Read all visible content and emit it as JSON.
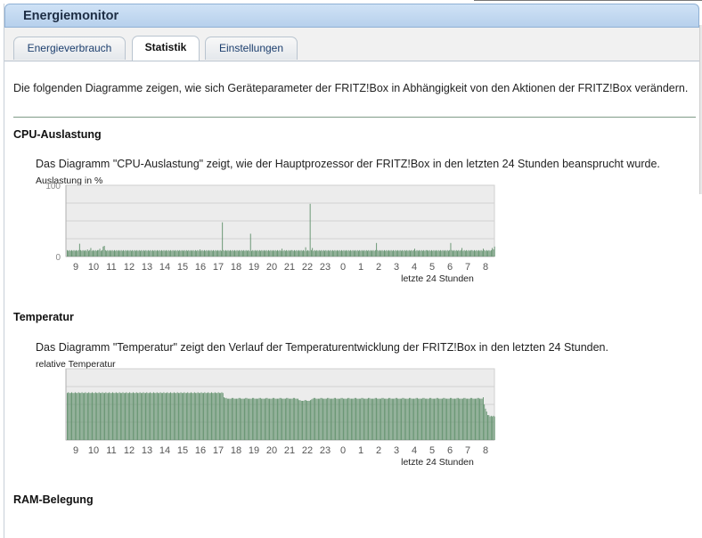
{
  "window": {
    "title": "Energiemonitor"
  },
  "tabs": [
    {
      "label": "Energieverbrauch",
      "active": false
    },
    {
      "label": "Statistik",
      "active": true
    },
    {
      "label": "Einstellungen",
      "active": false
    }
  ],
  "intro_text": "Die folgenden Diagramme zeigen, wie sich Geräteparameter der FRITZ!Box in Abhängigkeit von den Aktionen der FRITZ!Box verändern.",
  "sections": [
    {
      "title": "CPU-Auslastung",
      "description": "Das Diagramm \"CPU-Auslastung\" zeigt, wie der Hauptprozessor der FRITZ!Box in den letzten 24 Stunden beansprucht wurde."
    },
    {
      "title": "Temperatur",
      "description": "Das Diagramm \"Temperatur\" zeigt den Verlauf der Temperaturentwicklung der FRITZ!Box in den letzten 24 Stunden."
    },
    {
      "title": "RAM-Belegung"
    }
  ],
  "colors": {
    "bar": "#5f8f6a",
    "plot_bg": "#ececec",
    "grid": "#d2d2d2",
    "rule": "#7f9b87"
  },
  "chart_data": [
    {
      "type": "bar",
      "ylabel": "Auslastung in %",
      "xlabel": "letzte 24 Stunden",
      "ylim": [
        0,
        100
      ],
      "yticks": [
        "100",
        "0"
      ],
      "categories": [
        "9",
        "10",
        "11",
        "12",
        "13",
        "14",
        "15",
        "16",
        "17",
        "18",
        "19",
        "20",
        "21",
        "22",
        "23",
        "0",
        "1",
        "2",
        "3",
        "4",
        "5",
        "6",
        "7",
        "8"
      ],
      "grid": true,
      "values": [
        9,
        8,
        9,
        8,
        9,
        8,
        9,
        8,
        9,
        8,
        9,
        18,
        9,
        8,
        9,
        8,
        9,
        8,
        10,
        8,
        9,
        12,
        8,
        9,
        8,
        9,
        8,
        9,
        9,
        11,
        8,
        9,
        14,
        15,
        9,
        8,
        9,
        8,
        9,
        8,
        9,
        8,
        9,
        8,
        9,
        8,
        9,
        8,
        9,
        8,
        9,
        8,
        9,
        8,
        9,
        8,
        9,
        8,
        9,
        8,
        9,
        8,
        9,
        8,
        9,
        8,
        9,
        8,
        9,
        8,
        9,
        8,
        9,
        8,
        9,
        8,
        9,
        8,
        9,
        8,
        9,
        8,
        9,
        8,
        9,
        8,
        9,
        8,
        9,
        8,
        9,
        8,
        9,
        8,
        9,
        8,
        9,
        8,
        9,
        8,
        9,
        8,
        9,
        8,
        9,
        8,
        9,
        8,
        9,
        8,
        9,
        8,
        9,
        8,
        9,
        8,
        9,
        8,
        10,
        8,
        9,
        8,
        9,
        8,
        9,
        8,
        9,
        8,
        9,
        8,
        9,
        8,
        9,
        8,
        9,
        8,
        9,
        8,
        48,
        9,
        8,
        9,
        8,
        9,
        8,
        9,
        8,
        9,
        8,
        9,
        8,
        9,
        8,
        9,
        8,
        9,
        8,
        9,
        8,
        9,
        8,
        9,
        8,
        32,
        8,
        9,
        8,
        9,
        8,
        9,
        8,
        9,
        8,
        9,
        8,
        9,
        8,
        9,
        8,
        9,
        8,
        9,
        8,
        9,
        8,
        9,
        8,
        9,
        8,
        9,
        8,
        11,
        8,
        9,
        8,
        9,
        8,
        9,
        8,
        9,
        9,
        8,
        9,
        8,
        9,
        8,
        9,
        8,
        9,
        8,
        9,
        8,
        13,
        8,
        9,
        8,
        74,
        9,
        12,
        8,
        9,
        8,
        9,
        8,
        9,
        8,
        9,
        8,
        9,
        8,
        9,
        8,
        9,
        8,
        9,
        8,
        9,
        8,
        9,
        8,
        9,
        8,
        9,
        8,
        9,
        8,
        9,
        8,
        9,
        8,
        9,
        8,
        9,
        8,
        9,
        8,
        9,
        8,
        9,
        8,
        9,
        8,
        9,
        8,
        9,
        8,
        9,
        8,
        9,
        8,
        9,
        8,
        9,
        8,
        9,
        19,
        9,
        8,
        9,
        8,
        9,
        8,
        9,
        8,
        9,
        8,
        9,
        8,
        9,
        8,
        9,
        8,
        9,
        8,
        9,
        8,
        9,
        8,
        9,
        8,
        9,
        8,
        9,
        8,
        9,
        8,
        9,
        8,
        9,
        11,
        8,
        9,
        8,
        9,
        8,
        9,
        8,
        9,
        8,
        9,
        9,
        8,
        9,
        8,
        9,
        8,
        9,
        8,
        9,
        8,
        9,
        8,
        9,
        8,
        9,
        8,
        9,
        8,
        9,
        8,
        9,
        19,
        9,
        8,
        9,
        8,
        9,
        8,
        9,
        8,
        9,
        12,
        8,
        9,
        8,
        9,
        8,
        9,
        8,
        9,
        9,
        8,
        9,
        8,
        9,
        8,
        9,
        8,
        9,
        8,
        11,
        9,
        8,
        9,
        8,
        9,
        8,
        9,
        12,
        10,
        14
      ]
    },
    {
      "type": "bar",
      "ylabel": "relative Temperatur",
      "xlabel": "letzte 24 Stunden",
      "ylim": [
        0,
        100
      ],
      "categories": [
        "9",
        "10",
        "11",
        "12",
        "13",
        "14",
        "15",
        "16",
        "17",
        "18",
        "19",
        "20",
        "21",
        "22",
        "23",
        "0",
        "1",
        "2",
        "3",
        "4",
        "5",
        "6",
        "7",
        "8"
      ],
      "grid": true,
      "values": [
        66,
        67,
        66,
        66,
        67,
        66,
        66,
        67,
        66,
        66,
        67,
        66,
        66,
        67,
        66,
        66,
        67,
        66,
        66,
        67,
        66,
        66,
        67,
        66,
        66,
        67,
        66,
        66,
        67,
        66,
        66,
        67,
        66,
        66,
        67,
        66,
        66,
        67,
        66,
        66,
        67,
        66,
        66,
        67,
        66,
        66,
        67,
        66,
        66,
        67,
        66,
        66,
        67,
        66,
        66,
        67,
        66,
        66,
        67,
        66,
        66,
        67,
        66,
        66,
        67,
        66,
        66,
        67,
        66,
        66,
        67,
        66,
        66,
        67,
        66,
        66,
        67,
        66,
        66,
        67,
        66,
        66,
        67,
        66,
        66,
        67,
        66,
        66,
        67,
        66,
        66,
        67,
        66,
        66,
        67,
        66,
        66,
        67,
        66,
        66,
        67,
        66,
        66,
        67,
        66,
        66,
        67,
        66,
        66,
        67,
        66,
        66,
        67,
        66,
        66,
        67,
        66,
        66,
        67,
        66,
        66,
        67,
        66,
        66,
        67,
        66,
        66,
        67,
        66,
        66,
        67,
        66,
        66,
        67,
        66,
        66,
        67,
        66,
        60,
        59,
        59,
        58,
        58,
        58,
        58,
        59,
        59,
        58,
        58,
        58,
        58,
        59,
        59,
        58,
        58,
        58,
        58,
        59,
        59,
        58,
        58,
        58,
        58,
        59,
        59,
        58,
        58,
        58,
        58,
        59,
        59,
        58,
        58,
        58,
        58,
        59,
        59,
        58,
        58,
        58,
        58,
        59,
        59,
        58,
        58,
        58,
        58,
        59,
        59,
        58,
        58,
        58,
        58,
        59,
        59,
        58,
        58,
        58,
        58,
        59,
        59,
        58,
        58,
        58,
        56,
        56,
        55,
        55,
        55,
        56,
        56,
        55,
        55,
        55,
        56,
        57,
        58,
        59,
        59,
        58,
        58,
        58,
        58,
        59,
        59,
        58,
        58,
        58,
        58,
        59,
        59,
        58,
        58,
        58,
        58,
        59,
        59,
        58,
        58,
        58,
        58,
        59,
        59,
        58,
        58,
        58,
        58,
        59,
        59,
        58,
        58,
        58,
        58,
        59,
        59,
        58,
        58,
        58,
        58,
        59,
        59,
        58,
        58,
        58,
        58,
        59,
        59,
        58,
        58,
        58,
        58,
        59,
        59,
        58,
        58,
        58,
        58,
        59,
        59,
        58,
        58,
        58,
        58,
        59,
        59,
        58,
        58,
        58,
        58,
        59,
        59,
        58,
        58,
        58,
        58,
        59,
        59,
        58,
        58,
        58,
        58,
        59,
        59,
        58,
        58,
        58,
        58,
        59,
        59,
        58,
        58,
        58,
        58,
        59,
        59,
        58,
        58,
        58,
        58,
        59,
        59,
        58,
        58,
        58,
        58,
        59,
        59,
        58,
        58,
        58,
        58,
        59,
        59,
        58,
        58,
        58,
        58,
        59,
        59,
        58,
        58,
        58,
        58,
        59,
        59,
        58,
        58,
        58,
        58,
        59,
        59,
        58,
        58,
        58,
        58,
        59,
        59,
        58,
        58,
        58,
        58,
        59,
        59,
        58,
        58,
        58,
        60,
        50,
        44,
        40,
        35,
        35,
        33,
        34,
        33,
        34,
        33
      ]
    }
  ]
}
